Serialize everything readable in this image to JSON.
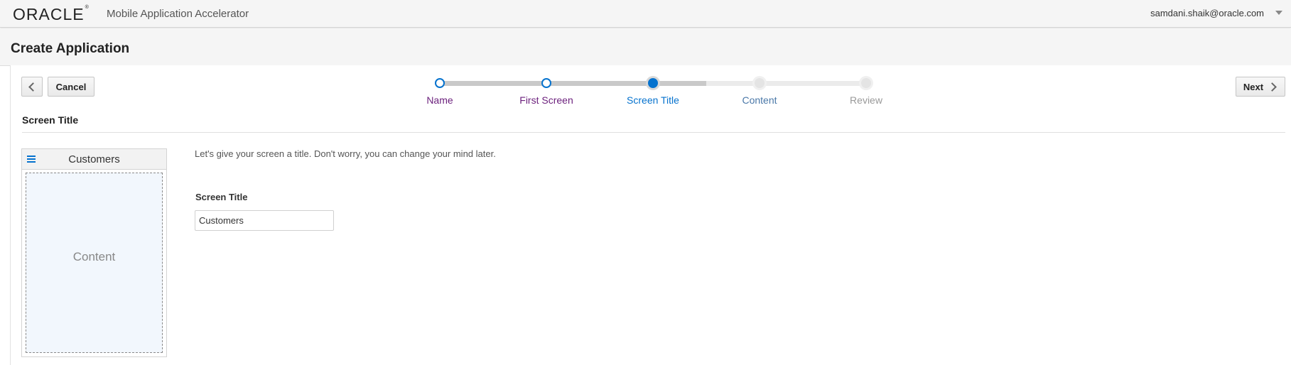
{
  "header": {
    "logo_text": "ORACLE",
    "logo_mark": "®",
    "app_name": "Mobile Application Accelerator",
    "user_email": "samdani.shaik@oracle.com",
    "user_menu_icon": "caret-down-icon"
  },
  "page": {
    "title": "Create Application"
  },
  "toolbar": {
    "back_icon": "chevron-left-icon",
    "cancel_label": "Cancel",
    "next_label": "Next",
    "next_icon": "chevron-right-icon"
  },
  "train": {
    "steps": [
      {
        "label": "Name",
        "state": "visited"
      },
      {
        "label": "First Screen",
        "state": "visited"
      },
      {
        "label": "Screen Title",
        "state": "current"
      },
      {
        "label": "Content",
        "state": "disabled"
      },
      {
        "label": "Review",
        "state": "unvisited"
      }
    ]
  },
  "section": {
    "title": "Screen Title"
  },
  "preview": {
    "menu_icon": "hamburger-menu-icon",
    "title": "Customers",
    "content_label": "Content"
  },
  "form": {
    "intro": "Let's give your screen a title. Don't worry, you can change your mind later.",
    "screen_title_label": "Screen Title",
    "screen_title_value": "Customers"
  },
  "colors": {
    "accent": "#0572ce",
    "visited_label": "#6b1f7c",
    "header_bg": "#f5f5f5"
  }
}
